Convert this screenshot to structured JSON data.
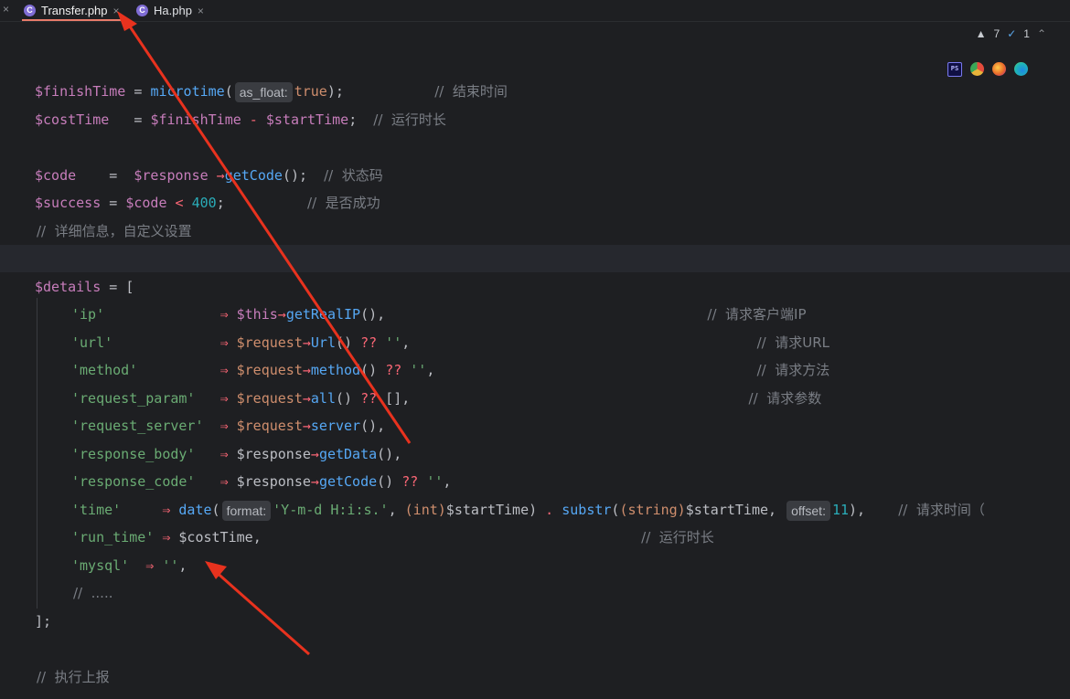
{
  "tabs": [
    {
      "label": "Transfer.php",
      "badge": "C",
      "close": "×",
      "active": true
    },
    {
      "label": "Ha.php",
      "badge": "C",
      "close": "×",
      "active": false
    }
  ],
  "leading_close": "×",
  "inspections": {
    "warnings": "7",
    "checks": "1"
  },
  "browsers": [
    {
      "name": "phpstorm-icon",
      "color": "#7a7af0",
      "label": "PS"
    },
    {
      "name": "chrome-icon",
      "color": "#e8b43a"
    },
    {
      "name": "firefox-icon",
      "color": "#e86a2a"
    },
    {
      "name": "edge-icon",
      "color": "#1fb6b4"
    }
  ],
  "code": {
    "l1": {
      "var": "$finishTime",
      "eq": " = ",
      "fn": "microtime",
      "p1": "(",
      "hint": "as_float:",
      "val": "true",
      "p2": ");",
      "sp": "           ",
      "comment": "//  结束时间"
    },
    "l2": {
      "var1": "$costTime",
      "eq": "   = ",
      "var2": "$finishTime",
      "minus": " - ",
      "var3": "$startTime",
      "semi": ";",
      "sp": "  ",
      "comment": "//  运行时长"
    },
    "l4": {
      "var1": "$code",
      "eq": "    =  ",
      "var2": "$response",
      "arrow": " →",
      "fn": "getCode",
      "end": "();",
      "sp": "  ",
      "comment": "//  状态码"
    },
    "l5": {
      "var1": "$success",
      "eq": " = ",
      "var2": "$code",
      "lt": " < ",
      "num": "400",
      "semi": ";",
      "sp": "          ",
      "comment": "//  是否成功"
    },
    "l6": {
      "comment": "//  详细信息，自定义设置"
    },
    "l8": {
      "var": "$details",
      "rest": " = ["
    },
    "l9": {
      "key": "'ip'",
      "sp": "              ",
      "arrow": "⇒",
      "var": " $this",
      "ar2": "→",
      "fn": "getRealIP",
      "end": "(),",
      "sp2": "                                       ",
      "comment": "//  请求客户端IP"
    },
    "l10": {
      "key": "'url'",
      "sp": "             ",
      "arrow": "⇒",
      "var": " $request",
      "ar2": "→",
      "fn": "Url",
      "p": "() ",
      "q": "??",
      "s": " ''",
      "end": ",",
      "sp2": "                                          ",
      "comment": "//  请求URL"
    },
    "l11": {
      "key": "'method'",
      "sp": "          ",
      "arrow": "⇒",
      "var": " $request",
      "ar2": "→",
      "fn": "method",
      "p": "() ",
      "q": "??",
      "s": " ''",
      "end": ",",
      "sp2": "                                       ",
      "comment": "//  请求方法"
    },
    "l12": {
      "key": "'request_param'",
      "sp": "   ",
      "arrow": "⇒",
      "var": " $request",
      "ar2": "→",
      "fn": "all",
      "p": "() ",
      "q": "??",
      "s": " []",
      "end": ",",
      "sp2": "                                         ",
      "comment": "//  请求参数"
    },
    "l13": {
      "key": "'request_server'",
      "sp": "  ",
      "arrow": "⇒",
      "var": " $request",
      "ar2": "→",
      "fn": "server",
      "end": "(),"
    },
    "l14": {
      "key": "'response_body'",
      "sp": "   ",
      "arrow": "⇒",
      "var": " $response",
      "ar2": "→",
      "fn": "getData",
      "end": "(),"
    },
    "l15": {
      "key": "'response_code'",
      "sp": "   ",
      "arrow": "⇒",
      "var": " $response",
      "ar2": "→",
      "fn": "getCode",
      "p": "() ",
      "q": "??",
      "s": " ''",
      "end": ","
    },
    "l16": {
      "key": "'time'",
      "sp": "     ",
      "arrow": "⇒",
      "fn": " date",
      "p1": "(",
      "hint1": "format:",
      "str": "'Y-m-d H:i:s.'",
      "comma": ", ",
      "cast1": "(int)",
      "var1": "$startTime",
      "p2": ") ",
      "dot": ".",
      "fn2": " substr",
      "p3": "(",
      "cast2": "(string)",
      "var2": "$startTime",
      "comma2": ", ",
      "hint2": "offset:",
      "num": "11",
      "end": "),",
      "sp2": "    ",
      "comment": "//  请求时间（"
    },
    "l17": {
      "key": "'run_time'",
      "sp": " ",
      "arrow": "⇒",
      "var": " $costTime",
      "end": ",",
      "sp2": "                                              ",
      "comment": "//  运行时长"
    },
    "l18": {
      "key": "'mysql'",
      "sp": "  ",
      "arrow": "⇒",
      "s": " ''",
      "end": ","
    },
    "l19": {
      "comment": "//  ....."
    },
    "l20": {
      "text": "];"
    },
    "l22": {
      "comment": "//  执行上报"
    }
  }
}
